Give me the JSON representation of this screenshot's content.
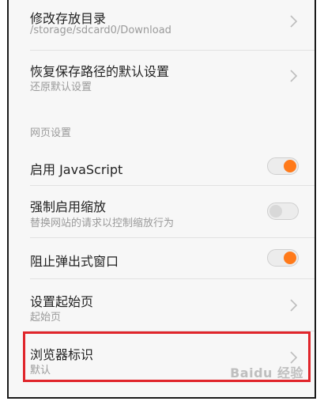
{
  "rows": [
    {
      "title": "修改存放目录",
      "subtitle": "/storage/sdcard0/Download"
    },
    {
      "title": "恢复保存路径的默认设置",
      "subtitle": "还原默认设置"
    }
  ],
  "section_label": "网页设置",
  "toggles": [
    {
      "title": "启用 JavaScript",
      "on": true
    },
    {
      "title": "强制启用缩放",
      "subtitle": "替换网站的请求以控制缩放行为",
      "on": false
    },
    {
      "title": "阻止弹出式窗口",
      "on": true
    }
  ],
  "more_rows": [
    {
      "title": "设置起始页",
      "subtitle": "起始页"
    },
    {
      "title": "浏览器标识",
      "subtitle": "默认"
    }
  ],
  "watermark": "Baidu 经验",
  "colors": {
    "accent": "#ff7a1a",
    "highlight": "#e0252b"
  },
  "icons": {
    "chevron": "chevron-right-icon"
  }
}
